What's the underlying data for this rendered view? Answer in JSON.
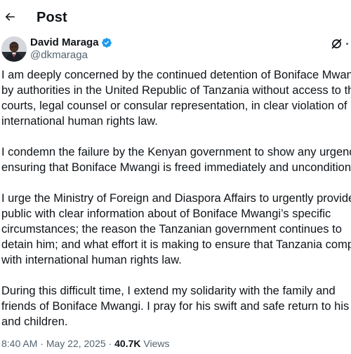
{
  "header": {
    "title": "Post"
  },
  "author": {
    "name": "David Maraga",
    "handle": "@dkmaraga",
    "verified_color": "#1d9bf0"
  },
  "icons": {
    "back": "back-arrow-icon",
    "verified": "verified-badge-icon",
    "grok": "grok-icon",
    "more": "more-icon"
  },
  "tweet": {
    "paragraphs": [
      [
        "I am deeply concerned by the continued detention of Boniface Mwangi",
        "by authorities in the United Republic of Tanzania without access to the",
        "courts, legal counsel or consular representation, in clear violation of",
        "international human rights law."
      ],
      [
        "I condemn the failure by the Kenyan government to show any urgency in",
        "ensuring that Boniface Mwangi is freed immediately and unconditionally."
      ],
      [
        "I urge the Ministry of Foreign and Diaspora Affairs to urgently provide the",
        "public with clear information about of Boniface Mwangi’s specific",
        "circumstances; the reason the Tanzanian government continues to",
        "detain him; and what effort it is making to ensure that Tanzania complies",
        "with international human rights law."
      ],
      [
        "During this difficult time, I extend my solidarity with the family and",
        "friends of Boniface Mwangi. I pray for his swift and safe return to his wife",
        "and children."
      ]
    ]
  },
  "meta": {
    "time": "8:40 AM",
    "separator": " · ",
    "date": "May 22, 2025",
    "views_count": "40.7K",
    "views_label": " Views"
  }
}
